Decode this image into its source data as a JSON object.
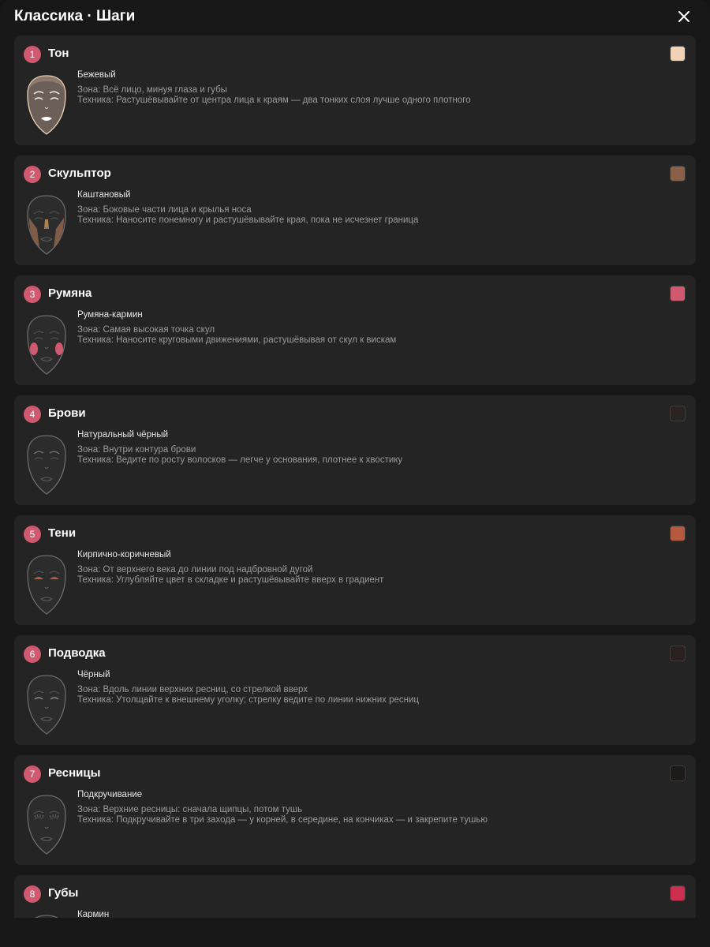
{
  "header": {
    "title": "Классика · Шаги",
    "close_icon": "close-icon"
  },
  "steps": [
    {
      "number": "1",
      "name": "Тон",
      "shade": "Бежевый",
      "swatch_color": "#f1d2b7",
      "zone": "Зона: Всё лицо, минуя глаза и губы",
      "technique": "Техника: Растушёвывайте от центра лица к краям — два тонких слоя лучше одного плотного",
      "icon": "face-foundation-icon"
    },
    {
      "number": "2",
      "name": "Скульптор",
      "shade": "Каштановый",
      "swatch_color": "#8a6049",
      "zone": "Зона: Боковые части лица и крылья носа",
      "technique": "Техника: Наносите понемногу и растушёвывайте края, пока не исчезнет граница",
      "icon": "face-contour-icon"
    },
    {
      "number": "3",
      "name": "Румяна",
      "shade": "Румяна-кармин",
      "swatch_color": "#d0596f",
      "zone": "Зона: Самая высокая точка скул",
      "technique": "Техника: Наносите круговыми движениями, растушёвывая от скул к вискам",
      "icon": "face-blush-icon"
    },
    {
      "number": "4",
      "name": "Брови",
      "shade": "Натуральный чёрный",
      "swatch_color": "#2b2320",
      "zone": "Зона: Внутри контура брови",
      "technique": "Техника: Ведите по росту волосков — легче у основания, плотнее к хвостику",
      "icon": "face-brows-icon"
    },
    {
      "number": "5",
      "name": "Тени",
      "shade": "Кирпично-коричневый",
      "swatch_color": "#b55a3f",
      "zone": "Зона: От верхнего века до линии под надбровной дугой",
      "technique": "Техника: Углубляйте цвет в складке и растушёвывайте вверх в градиент",
      "icon": "face-eyeshadow-icon"
    },
    {
      "number": "6",
      "name": "Подводка",
      "shade": "Чёрный",
      "swatch_color": "#2a201d",
      "zone": "Зона: Вдоль линии верхних ресниц, со стрелкой вверх",
      "technique": "Техника: Утолщайте к внешнему уголку; стрелку ведите по линии нижних ресниц",
      "icon": "face-eyeliner-icon"
    },
    {
      "number": "7",
      "name": "Ресницы",
      "shade": "Подкручивание",
      "swatch_color": "#1d1a19",
      "zone": "Зона: Верхние ресницы: сначала щипцы, потом тушь",
      "technique": "Техника: Подкручивайте в три захода — у корней, в середине, на кончиках — и закрепите тушью",
      "icon": "face-lashes-icon"
    },
    {
      "number": "8",
      "name": "Губы",
      "shade": "Кармин",
      "swatch_color": "#cc2f4f",
      "zone": "",
      "technique": "",
      "icon": "face-lips-icon"
    }
  ]
}
